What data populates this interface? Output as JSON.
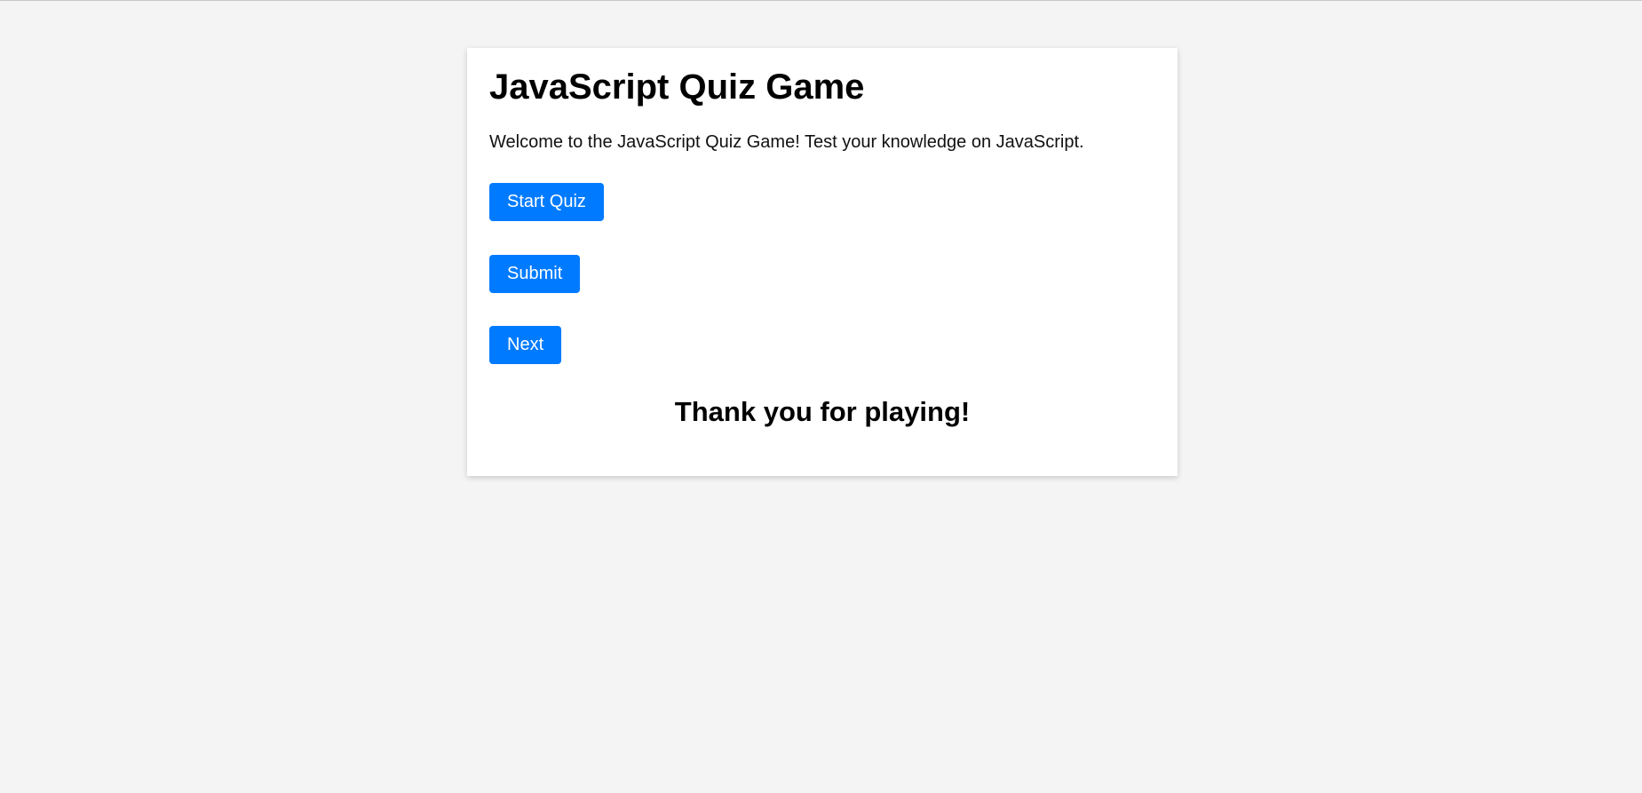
{
  "quiz": {
    "title": "JavaScript Quiz Game",
    "welcome_text": "Welcome to the JavaScript Quiz Game! Test your knowledge on JavaScript.",
    "start_label": "Start Quiz",
    "submit_label": "Submit",
    "next_label": "Next",
    "thanks_text": "Thank you for playing!"
  },
  "colors": {
    "page_background": "#f4f4f4",
    "card_background": "#ffffff",
    "button_background": "#007bff",
    "button_text": "#ffffff"
  }
}
